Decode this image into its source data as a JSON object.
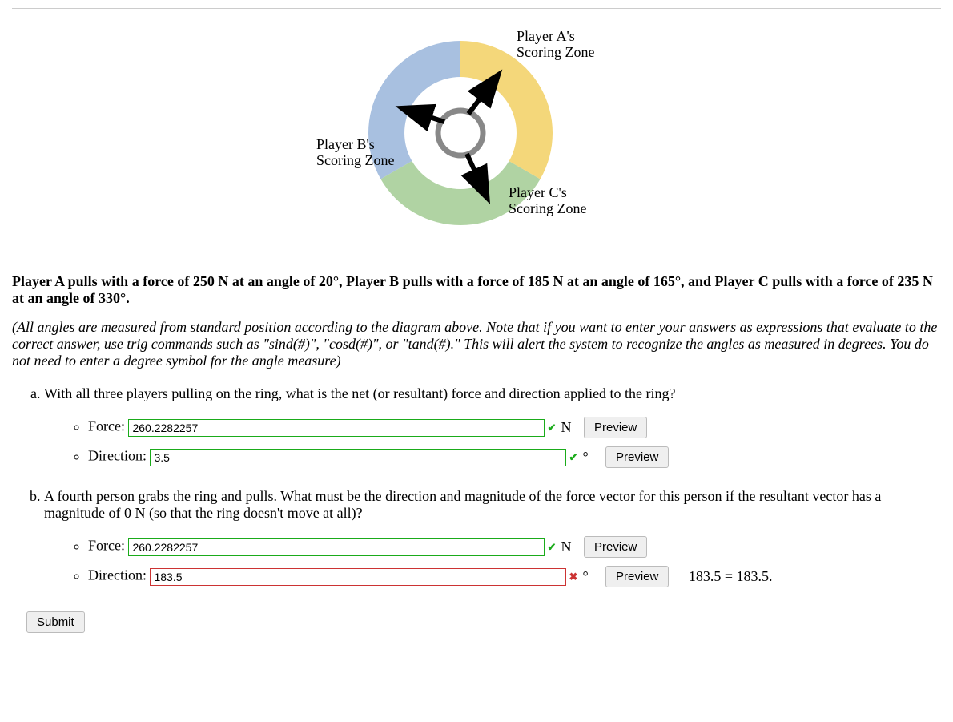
{
  "diagram": {
    "labels": {
      "a": "Player A's\nScoring Zone",
      "b": "Player B's\nScoring Zone",
      "c": "Player C's\nScoring Zone"
    }
  },
  "problem_statement": "Player A pulls with a force of 250 N at an angle of 20°, Player B pulls with a force of 185 N at an angle of 165°, and Player C pulls with a force of 235 N at an angle of 330°.",
  "instructions": "(All angles are measured from standard position according to the diagram above. Note that if you want to enter your answers as expressions that evaluate to the correct answer, use trig commands such as \"sind(#)\", \"cosd(#)\", or \"tand(#).\" This will alert the system to recognize the angles as measured in degrees. You do not need to enter a degree symbol for the angle measure)",
  "parts": {
    "a": {
      "prompt": "With all three players pulling on the ring, what is the net (or resultant) force and direction applied to the ring?",
      "fields": {
        "force": {
          "label": "Force:",
          "value": "260.2282257",
          "unit": "N",
          "status": "correct",
          "preview_label": "Preview"
        },
        "direction": {
          "label": "Direction:",
          "value": "3.5",
          "unit": "°",
          "status": "correct",
          "preview_label": "Preview"
        }
      }
    },
    "b": {
      "prompt": "A fourth person grabs the ring and pulls. What must be the direction and magnitude of the force vector for this person if the resultant vector has a magnitude of 0 N (so that the ring doesn't move at all)?",
      "fields": {
        "force": {
          "label": "Force:",
          "value": "260.2282257",
          "unit": "N",
          "status": "correct",
          "preview_label": "Preview"
        },
        "direction": {
          "label": "Direction:",
          "value": "183.5",
          "unit": "°",
          "status": "incorrect",
          "preview_label": "Preview",
          "feedback": "183.5  =  183.5."
        }
      }
    }
  },
  "submit_label": "Submit"
}
